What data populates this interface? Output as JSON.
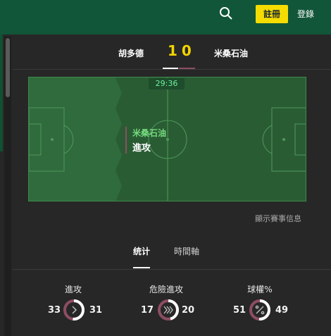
{
  "header": {
    "register_label": "註冊",
    "login_label": "登錄"
  },
  "match": {
    "home_team": "胡多德",
    "away_team": "米桑石油",
    "home_score": "1",
    "away_score": "0",
    "time": "29:36"
  },
  "event": {
    "team": "米桑石油",
    "action": "進攻"
  },
  "more_link": "顯示賽事信息",
  "tabs": [
    {
      "label": "统计"
    },
    {
      "label": "時間軸"
    }
  ],
  "stats": [
    {
      "title": "進攻",
      "home": "33",
      "away": "31",
      "home_share": 0.516,
      "icon": "chevron-right-icon"
    },
    {
      "title": "危險進攻",
      "home": "17",
      "away": "20",
      "home_share": 0.459,
      "icon": "double-chevron-icon"
    },
    {
      "title": "球權%",
      "home": "51",
      "away": "49",
      "home_share": 0.51,
      "icon": "percent-icon"
    }
  ],
  "colors": {
    "home": "#ffffff",
    "away": "#8d4d63",
    "pitch": "#2f6b3c",
    "topbar": "#115639",
    "accent": "#f5dc00"
  }
}
